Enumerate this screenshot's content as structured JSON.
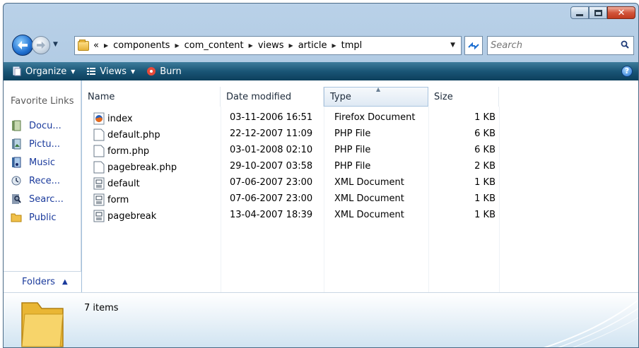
{
  "window": {
    "caption": {
      "minimize": "minimize",
      "maximize": "maximize",
      "close": "close"
    }
  },
  "address": {
    "overflow": "«",
    "crumbs": [
      "components",
      "com_content",
      "views",
      "article",
      "tmpl"
    ]
  },
  "search": {
    "placeholder": "Search"
  },
  "commands": {
    "organize": "Organize",
    "views": "Views",
    "burn": "Burn",
    "help": "?"
  },
  "nav": {
    "title": "Favorite Links",
    "items": [
      {
        "label": "Docu...",
        "icon": "documents-icon"
      },
      {
        "label": "Pictu...",
        "icon": "pictures-icon"
      },
      {
        "label": "Music",
        "icon": "music-icon"
      },
      {
        "label": "Rece...",
        "icon": "recent-icon"
      },
      {
        "label": "Searc...",
        "icon": "searches-icon"
      },
      {
        "label": "Public",
        "icon": "public-folder-icon"
      }
    ],
    "folders_label": "Folders"
  },
  "columns": {
    "name": "Name",
    "date": "Date modified",
    "type": "Type",
    "size": "Size"
  },
  "files": [
    {
      "name": "index",
      "date": "03-11-2006 16:51",
      "type": "Firefox Document",
      "size": "1 KB",
      "icon": "firefox-document-icon"
    },
    {
      "name": "default.php",
      "date": "22-12-2007 11:09",
      "type": "PHP File",
      "size": "6 KB",
      "icon": "file-icon"
    },
    {
      "name": "form.php",
      "date": "03-01-2008 02:10",
      "type": "PHP File",
      "size": "6 KB",
      "icon": "file-icon"
    },
    {
      "name": "pagebreak.php",
      "date": "29-10-2007 03:58",
      "type": "PHP File",
      "size": "2 KB",
      "icon": "file-icon"
    },
    {
      "name": "default",
      "date": "07-06-2007 23:00",
      "type": "XML Document",
      "size": "1 KB",
      "icon": "xml-document-icon"
    },
    {
      "name": "form",
      "date": "07-06-2007 23:00",
      "type": "XML Document",
      "size": "1 KB",
      "icon": "xml-document-icon"
    },
    {
      "name": "pagebreak",
      "date": "13-04-2007 18:39",
      "type": "XML Document",
      "size": "1 KB",
      "icon": "xml-document-icon"
    }
  ],
  "details": {
    "count": "7 items"
  },
  "colors": {
    "command_bar": "#1a5576",
    "nav_link": "#1a3a9c",
    "close_button": "#d2553b"
  }
}
